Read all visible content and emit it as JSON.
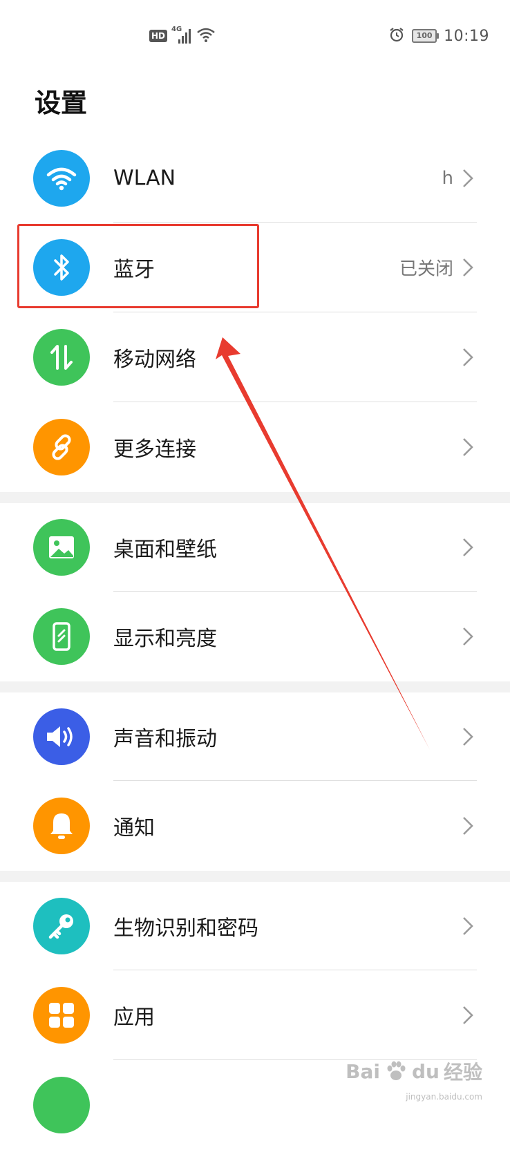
{
  "status_bar": {
    "hd_badge": "HD",
    "network": "4G",
    "battery": "100",
    "time": "10:19"
  },
  "page": {
    "title": "设置"
  },
  "groups": [
    {
      "items": [
        {
          "label": "WLAN",
          "value": "h",
          "icon": "wifi-icon",
          "color": "#1ea7ee"
        },
        {
          "label": "蓝牙",
          "value": "已关闭",
          "icon": "bluetooth-icon",
          "color": "#1ea7ee"
        },
        {
          "label": "移动网络",
          "value": "",
          "icon": "mobile-data-icon",
          "color": "#3fc45a"
        },
        {
          "label": "更多连接",
          "value": "",
          "icon": "link-icon",
          "color": "#ff9500"
        }
      ]
    },
    {
      "items": [
        {
          "label": "桌面和壁纸",
          "icon": "wallpaper-icon",
          "color": "#3fc45a"
        },
        {
          "label": "显示和亮度",
          "icon": "display-icon",
          "color": "#3fc45a"
        }
      ]
    },
    {
      "items": [
        {
          "label": "声音和振动",
          "icon": "sound-icon",
          "color": "#3b5ee6"
        },
        {
          "label": "通知",
          "icon": "bell-icon",
          "color": "#ff9500"
        }
      ]
    },
    {
      "items": [
        {
          "label": "生物识别和密码",
          "icon": "key-icon",
          "color": "#1ebfbf"
        },
        {
          "label": "应用",
          "icon": "apps-grid-icon",
          "color": "#ff9500"
        }
      ]
    }
  ],
  "annotation": {
    "color": "#e83b2f"
  },
  "watermark": {
    "brand": "Bai",
    "brand2": "du",
    "suffix": "经验",
    "url": "jingyan.baidu.com"
  }
}
